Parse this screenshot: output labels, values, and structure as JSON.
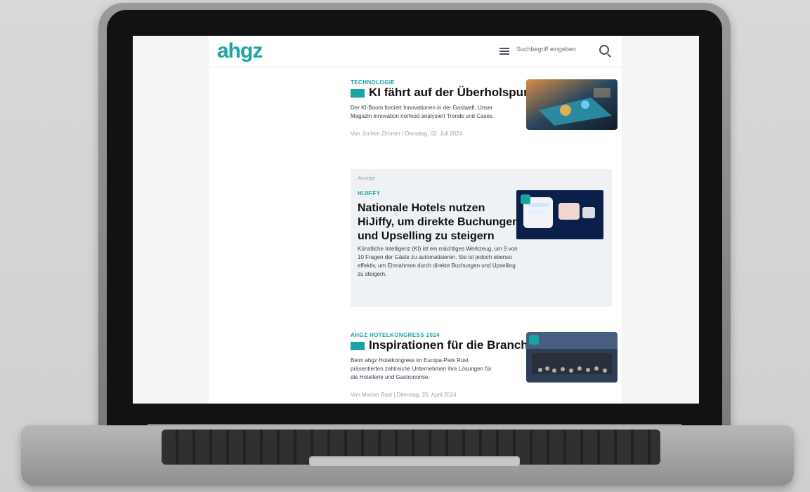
{
  "site": {
    "logo": "ahgz",
    "search_placeholder": "Suchbegriff eingeben"
  },
  "articles": [
    {
      "kicker": "TECHNOLOGIE",
      "title": "KI fährt auf der Überholspur",
      "desc": "Der KI-Boom forciert Innovationen in der Gastwelt. Unser Magazin innovation norfood analysiert Trends und Cases.",
      "meta": "Von Jochen Zimmer | Dienstag, 02. Juli 2024"
    },
    {
      "kicker": "HIJIFFY",
      "title": "Nationale Hotels nutzen HiJiffy, um direkte Buchungen und Upselling zu steigern",
      "desc": "Künstliche Intelligenz (KI) ist ein mächtiges Werkzeug, um 9 von 10 Fragen der Gäste zu automatisieren. Sie ist jedoch ebenso effektiv, um Einnahmen durch direkte Buchungen und Upselling zu steigern.",
      "sponsored_label": "Anzeige"
    },
    {
      "kicker": "AHGZ HOTELKONGRESS 2024",
      "title": "Inspirationen für die Branche",
      "desc": "Beim ahgz Hotelkongress im Europa-Park Rust präsentierten zahlreiche Unternehmen ihre Lösungen für die Hotellerie und Gastronomie.",
      "meta": "Von Marion Rost | Dienstag, 25. April 2024"
    }
  ],
  "colors": {
    "accent": "#1aa3a3"
  }
}
